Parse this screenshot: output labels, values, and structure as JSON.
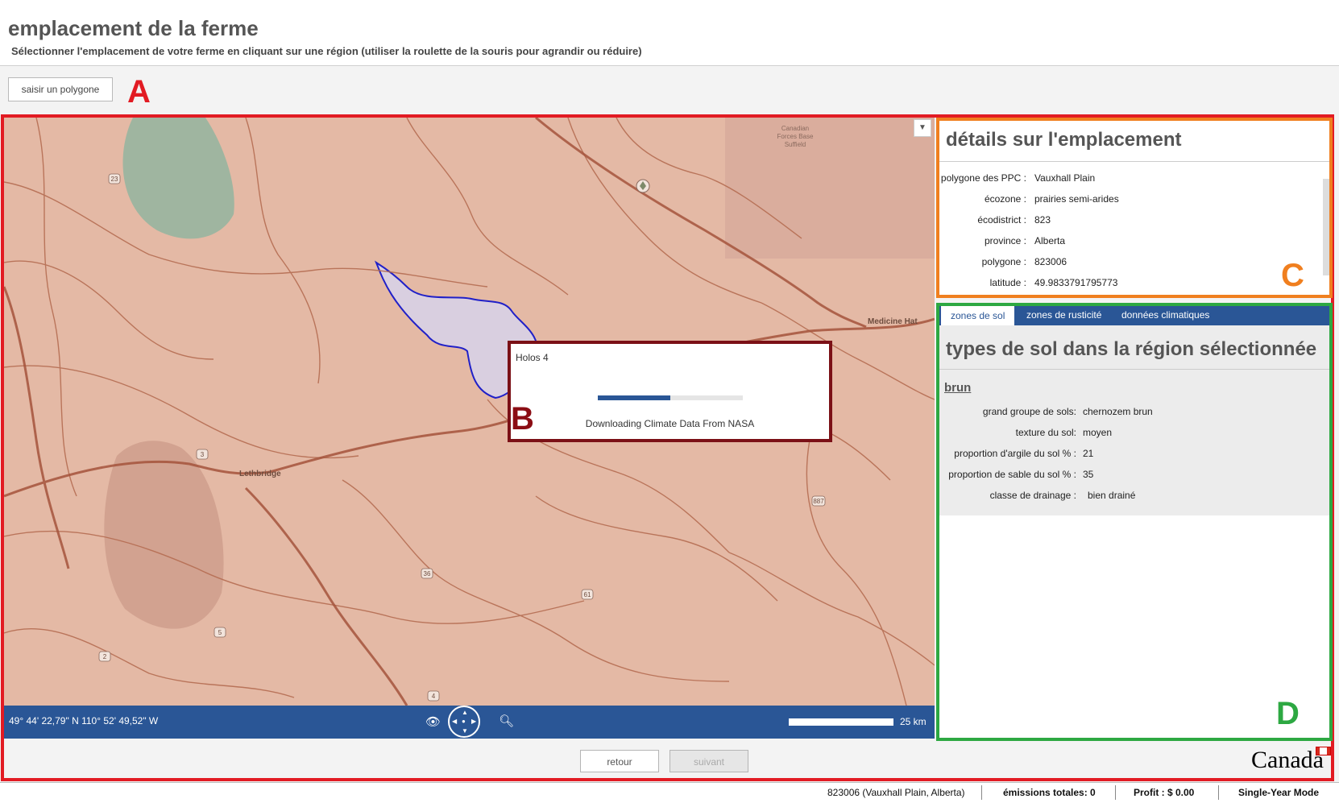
{
  "header": {
    "title": "emplacement de la ferme",
    "subtitle": "Sélectionner l'emplacement de votre ferme en cliquant sur une région (utiliser la roulette de la souris pour agrandir ou réduire)"
  },
  "toolbar": {
    "polygon_button": "saisir un polygone"
  },
  "annotations": {
    "a": "A",
    "b": "B",
    "c": "C",
    "d": "D"
  },
  "map": {
    "labels": {
      "medicine_hat": "Medicine Hat",
      "lethbridge": "Lethbridge",
      "cfb": [
        "Canadian",
        "Forces Base",
        "Suffield"
      ]
    },
    "highways": [
      "23",
      "3",
      "36",
      "61",
      "5",
      "2",
      "4",
      "887"
    ],
    "dropdown_icon": "chevron-down-icon",
    "coordinates": "49° 44' 22,79\" N 110° 52' 49,52\" W",
    "scale_label": "25 km"
  },
  "dialog": {
    "title": "Holos 4",
    "message": "Downloading Climate Data From NASA",
    "progress": 0.5
  },
  "location_details": {
    "title": "détails sur l'emplacement",
    "rows": [
      {
        "label": "polygone des PPC :",
        "value": "Vauxhall Plain"
      },
      {
        "label": "écozone :",
        "value": "prairies semi-arides"
      },
      {
        "label": "écodistrict :",
        "value": "823"
      },
      {
        "label": "province :",
        "value": "Alberta"
      },
      {
        "label": "polygone :",
        "value": "823006"
      },
      {
        "label": "latitude :",
        "value": "49.9833791795773"
      }
    ]
  },
  "tabs": [
    {
      "label": "zones de sol",
      "active": true
    },
    {
      "label": "zones de rusticité",
      "active": false
    },
    {
      "label": "données climatiques",
      "active": false
    }
  ],
  "soil": {
    "title": "types de sol dans la région sélectionnée",
    "name": "brun",
    "rows": [
      {
        "label": "grand groupe de sols:",
        "value": "chernozem brun"
      },
      {
        "label": "texture du sol:",
        "value": "moyen"
      },
      {
        "label": "proportion d'argile du sol % :",
        "value": "21"
      },
      {
        "label": "proportion de sable du sol % :",
        "value": "35"
      },
      {
        "label": "classe de drainage :",
        "value": "bien drainé"
      }
    ]
  },
  "navigation": {
    "back": "retour",
    "next": "suivant"
  },
  "brand": {
    "wordmark": "Canada"
  },
  "status_bar": {
    "location": "823006 (Vauxhall Plain, Alberta)",
    "emissions": "émissions totales: 0",
    "profit": "Profit :  $ 0.00",
    "mode": "Single-Year Mode"
  },
  "colors": {
    "accent_blue": "#2a5696",
    "outline_a": "#e21b23",
    "outline_b": "#7b1016",
    "outline_c": "#f07f1f",
    "outline_d": "#2da842",
    "map_fill": "#e4b9a5",
    "selected_polygon": "#2020c8"
  }
}
